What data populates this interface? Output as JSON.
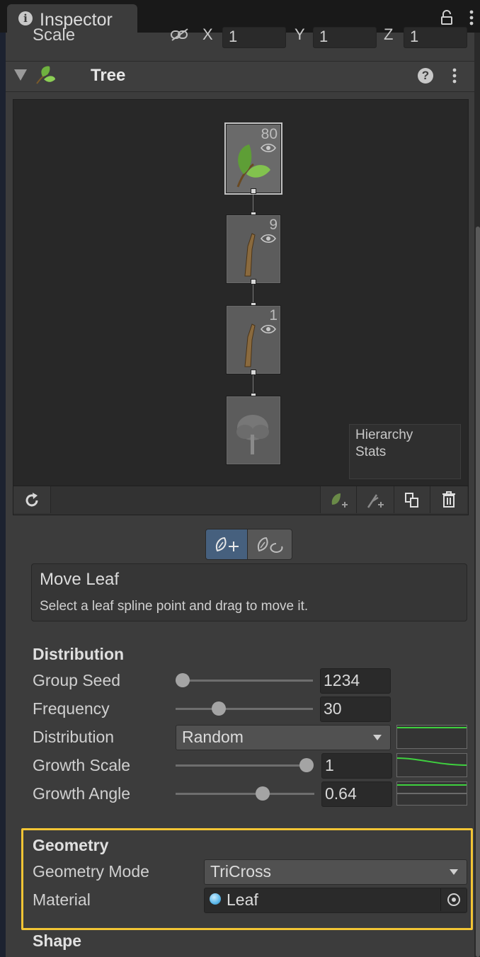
{
  "window": {
    "tab_label": "Inspector",
    "lock_icon": "lock-icon",
    "menu_icon": "kebab-menu-icon"
  },
  "transform": {
    "scale_label": "Scale",
    "constrain_icon": "link-icon",
    "x_label": "X",
    "x_value": "1",
    "y_label": "Y",
    "y_value": "1",
    "z_label": "Z",
    "z_value": "1"
  },
  "component": {
    "title": "Tree",
    "icon": "tree-leaf-icon",
    "help_icon": "help-icon",
    "menu_icon": "kebab-menu-icon"
  },
  "graph": {
    "nodes": [
      {
        "type": "leaf-group",
        "count": "80",
        "icon": "leaf-icon",
        "selected": true
      },
      {
        "type": "branch-group",
        "count": "9",
        "icon": "branch-icon"
      },
      {
        "type": "branch-group",
        "count": "1",
        "icon": "branch-icon"
      },
      {
        "type": "root",
        "count": "",
        "icon": "tree-icon"
      }
    ],
    "stats": {
      "line1": "Hierarchy",
      "line2": "Stats"
    }
  },
  "graph_toolbar": {
    "refresh_icon": "refresh-icon",
    "add_leaf_icon": "add-leaf-icon",
    "add_branch_icon": "add-branch-icon",
    "duplicate_icon": "duplicate-icon",
    "delete_icon": "trash-icon"
  },
  "mode": {
    "move_icon": "move-leaf-icon",
    "rotate_icon": "rotate-leaf-icon",
    "help_title": "Move Leaf",
    "help_text": "Select a leaf spline point and drag to move it."
  },
  "distribution": {
    "section_label": "Distribution",
    "group_seed": {
      "label": "Group Seed",
      "value": "1234",
      "slider_fraction": 0.05
    },
    "frequency": {
      "label": "Frequency",
      "value": "30",
      "slider_fraction": 0.32
    },
    "distribution": {
      "label": "Distribution",
      "value": "Random"
    },
    "growth_scale": {
      "label": "Growth Scale",
      "value": "1",
      "slider_fraction": 0.95
    },
    "growth_angle": {
      "label": "Growth Angle",
      "value": "0.64",
      "slider_fraction": 0.64
    }
  },
  "geometry": {
    "section_label": "Geometry",
    "mode": {
      "label": "Geometry Mode",
      "value": "TriCross"
    },
    "material": {
      "label": "Material",
      "value": "Leaf",
      "icon": "material-sphere-icon",
      "picker_icon": "object-picker-icon"
    }
  },
  "shape": {
    "section_label": "Shape"
  },
  "colors": {
    "highlight": "#f2c535",
    "curve_green": "#3fd13f",
    "active_mode": "#46607e"
  }
}
